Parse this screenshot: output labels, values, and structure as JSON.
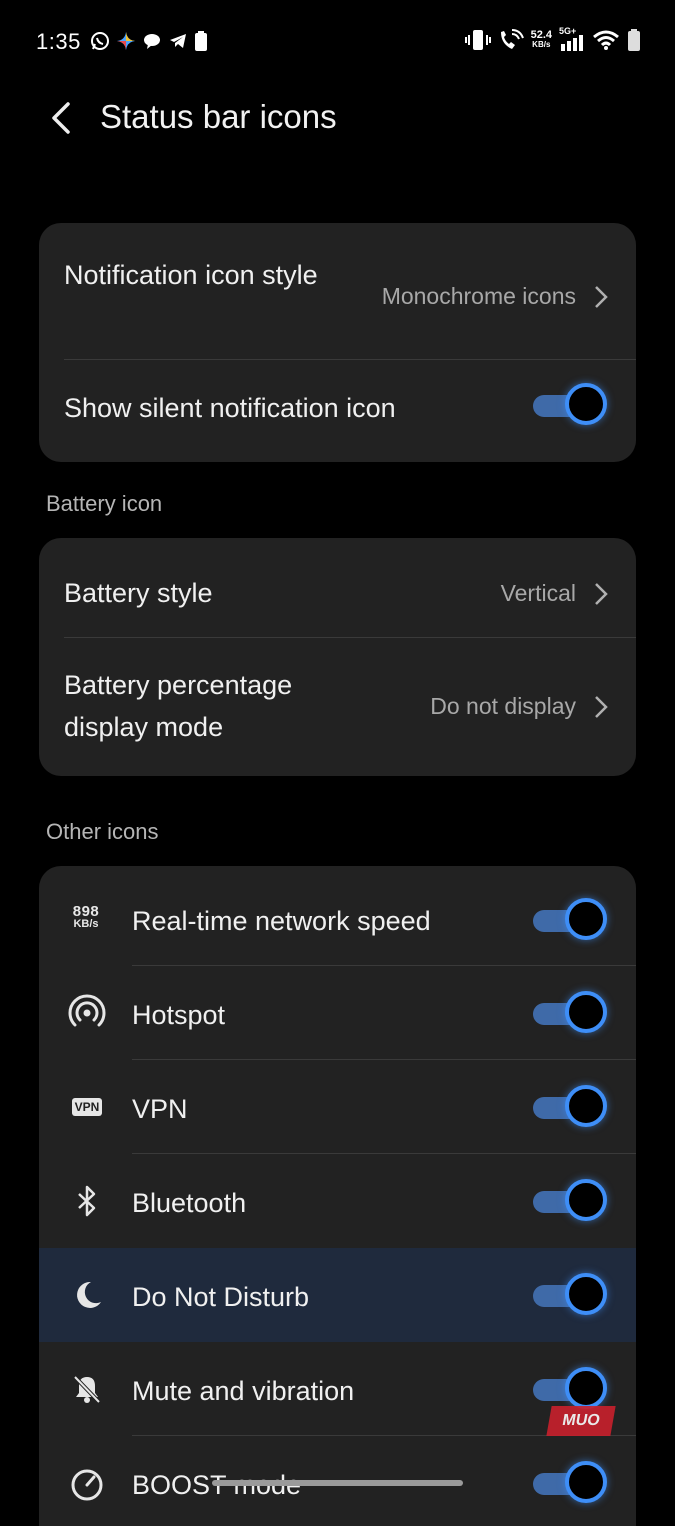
{
  "status_bar": {
    "time": "1:35",
    "speed_value": "52.4",
    "speed_unit": "KB/s",
    "network": "5G+"
  },
  "header": {
    "title": "Status bar icons"
  },
  "notification_card": {
    "style_label": "Notification icon style",
    "style_value": "Monochrome icons",
    "silent_label": "Show silent notification icon",
    "silent_on": true
  },
  "battery_section": {
    "title": "Battery icon",
    "style_label": "Battery style",
    "style_value": "Vertical",
    "percentage_label": "Battery percentage display mode",
    "percentage_value": "Do not display"
  },
  "other_section": {
    "title": "Other icons",
    "net_icon_number": "898",
    "net_icon_unit": "KB/s",
    "vpn_icon_text": "VPN",
    "items": [
      {
        "label": "Real-time network speed",
        "icon": "network-speed-icon",
        "on": true
      },
      {
        "label": "Hotspot",
        "icon": "hotspot-icon",
        "on": true
      },
      {
        "label": "VPN",
        "icon": "vpn-icon",
        "on": true
      },
      {
        "label": "Bluetooth",
        "icon": "bluetooth-icon",
        "on": true
      },
      {
        "label": "Do Not Disturb",
        "icon": "moon-icon",
        "on": true
      },
      {
        "label": "Mute and vibration",
        "icon": "bell-off-icon",
        "on": true
      },
      {
        "label": "BOOST mode",
        "icon": "gauge-icon",
        "on": true
      }
    ]
  },
  "watermark": "MUO",
  "colors": {
    "accent": "#3e8ef7",
    "track": "#3f6aa8",
    "card": "#222222",
    "highlight": "#1f2a3d"
  }
}
